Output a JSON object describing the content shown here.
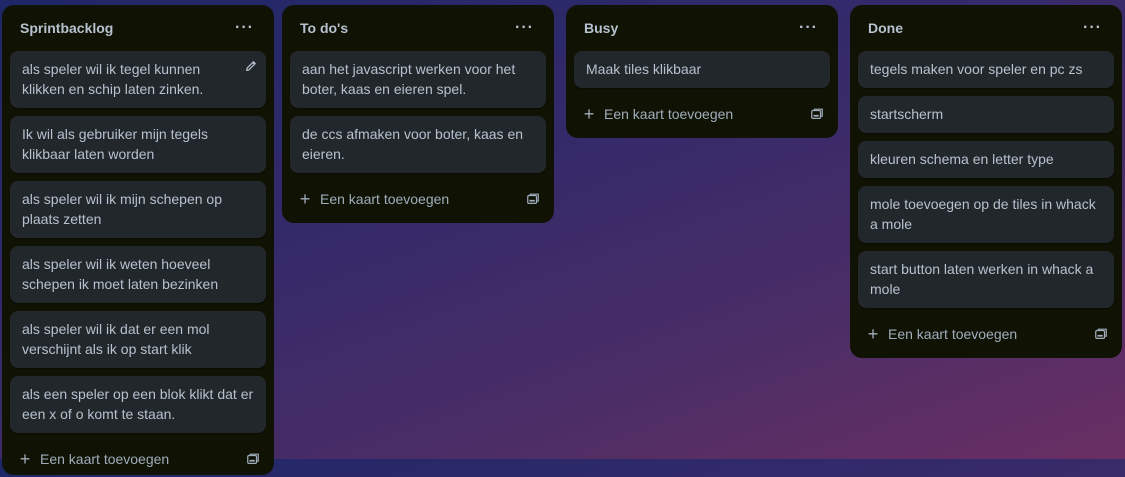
{
  "lists": [
    {
      "title": "Sprintbacklog",
      "cards": [
        "als speler wil ik tegel kunnen klikken en schip laten zinken.",
        "Ik wil als gebruiker mijn tegels klikbaar laten worden",
        "als speler wil ik mijn schepen op plaats zetten",
        "als speler wil ik weten hoeveel schepen ik moet laten bezinken",
        "als speler wil ik dat er een mol verschijnt als ik op start klik",
        "als een speler op een blok klikt dat er een x of o komt te staan."
      ],
      "add_label": "Een kaart toevoegen"
    },
    {
      "title": "To do's",
      "cards": [
        "aan het javascript werken voor het boter, kaas en eieren spel.",
        "de ccs afmaken voor boter, kaas en eieren."
      ],
      "add_label": "Een kaart toevoegen"
    },
    {
      "title": "Busy",
      "cards": [
        "Maak tiles klikbaar"
      ],
      "add_label": "Een kaart toevoegen"
    },
    {
      "title": "Done",
      "cards": [
        "tegels maken voor speler en pc zs",
        "startscherm",
        "kleuren schema en letter type",
        "mole toevoegen op de tiles in whack a mole",
        "start button laten werken in whack a mole"
      ],
      "add_label": "Een kaart toevoegen"
    }
  ],
  "menu_icon": "ellipsis-icon",
  "colors": {
    "list_bg": "#101204",
    "card_bg": "#22272b",
    "text": "#b6c2cf"
  }
}
